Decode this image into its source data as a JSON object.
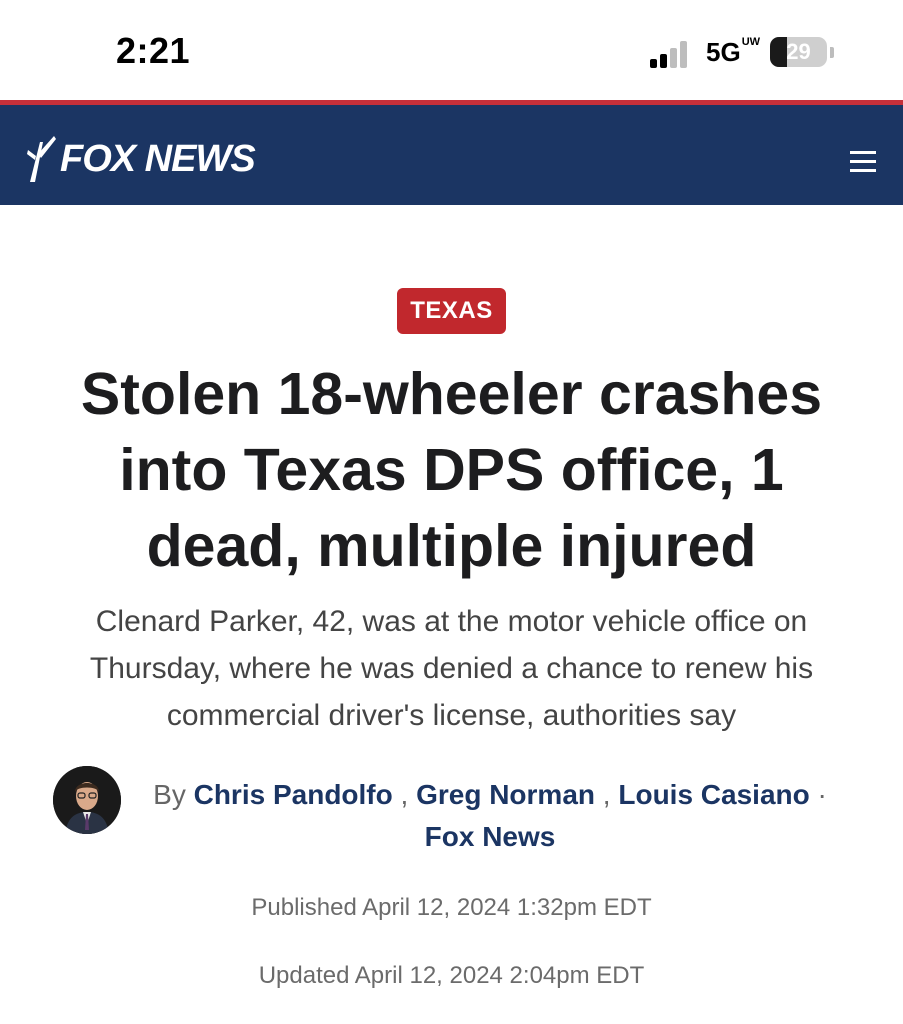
{
  "status_bar": {
    "time": "2:21",
    "network": "5G",
    "network_superscript": "UW",
    "battery_percent": 29
  },
  "header": {
    "logo_text": "FOX NEWS",
    "menu_icon": "hamburger-menu-icon",
    "bg_color": "#1b3563",
    "accent_color": "#c6303a"
  },
  "article": {
    "category": "TEXAS",
    "category_color": "#c1282d",
    "headline": "Stolen 18-wheeler crashes into Texas DPS office, 1 dead, multiple injured",
    "dek": "Clenard Parker, 42, was at the motor vehicle office on Thursday, where he was denied a chance to renew his commercial driver's license, authorities say",
    "byline": {
      "prefix": "By",
      "authors": [
        "Chris Pandolfo",
        "Greg Norman",
        "Louis Casiano"
      ],
      "separator": ",",
      "dot": "·",
      "outlet": "Fox News"
    },
    "published": "Published April 12, 2024 1:32pm EDT",
    "updated": "Updated April 12, 2024 2:04pm EDT"
  }
}
